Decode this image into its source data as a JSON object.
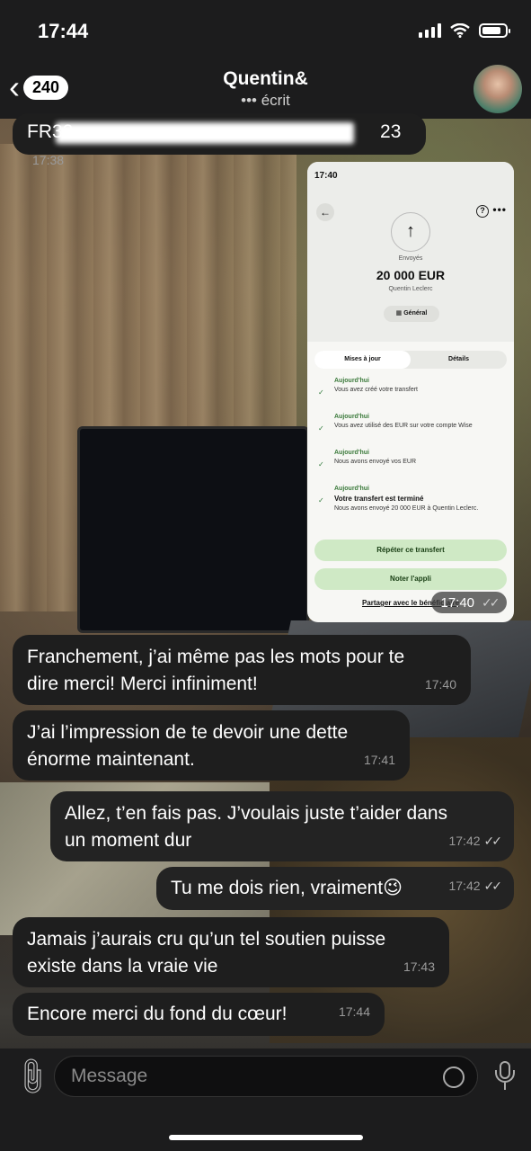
{
  "status_bar": {
    "time": "17:44"
  },
  "header": {
    "unread_count": "240",
    "contact_name": "Quentin&",
    "contact_status": "••• écrit"
  },
  "messages": [
    {
      "text": "FR32",
      "text_end": "23",
      "time": "17:38",
      "direction": "in"
    },
    {
      "type": "image",
      "time": "17:40",
      "direction": "out"
    },
    {
      "text_line1": "Franchement, j’ai même pas les mots pour te",
      "text_line2": "dire merci! Merci infiniment!",
      "time": "17:40",
      "direction": "in"
    },
    {
      "text_line1": "J’ai l’impression de te devoir une dette",
      "text_line2": "énorme maintenant.",
      "time": "17:41",
      "direction": "in"
    },
    {
      "text_line1": "Allez, t’en fais pas. J’voulais juste t’aider dans",
      "text_line2": "un moment dur",
      "time": "17:42",
      "direction": "out"
    },
    {
      "text": "Tu me dois rien, vraiment😉",
      "time": "17:42",
      "direction": "out"
    },
    {
      "text_line1": "Jamais j’aurais cru qu’un tel soutien puisse",
      "text_line2": "existe dans la vraie vie",
      "time": "17:43",
      "direction": "in"
    },
    {
      "text": "Encore merci du fond du cœur!",
      "time": "17:44",
      "direction": "in"
    }
  ],
  "transfer_screenshot": {
    "time": "17:40",
    "status_label": "Envoyés",
    "amount": "20 000 EUR",
    "recipient": "Quentin Leclerc",
    "chip": "Général",
    "tabs": [
      "Mises à jour",
      "Détails"
    ],
    "steps": [
      {
        "when": "Aujourd'hui",
        "text": "Vous avez créé votre transfert"
      },
      {
        "when": "Aujourd'hui",
        "text": "Vous avez utilisé des EUR sur votre compte Wise"
      },
      {
        "when": "Aujourd'hui",
        "text": "Nous avons envoyé vos EUR"
      },
      {
        "when": "Aujourd'hui",
        "text": "Votre transfert est terminé",
        "sub": "Nous avons envoyé 20 000 EUR à Quentin Leclerc."
      }
    ],
    "buttons": [
      "Répéter ce transfert",
      "Noter l'appli"
    ],
    "share_link": "Partager avec le bénéficiaire"
  },
  "input": {
    "placeholder": "Message"
  },
  "checks": "✓✓"
}
